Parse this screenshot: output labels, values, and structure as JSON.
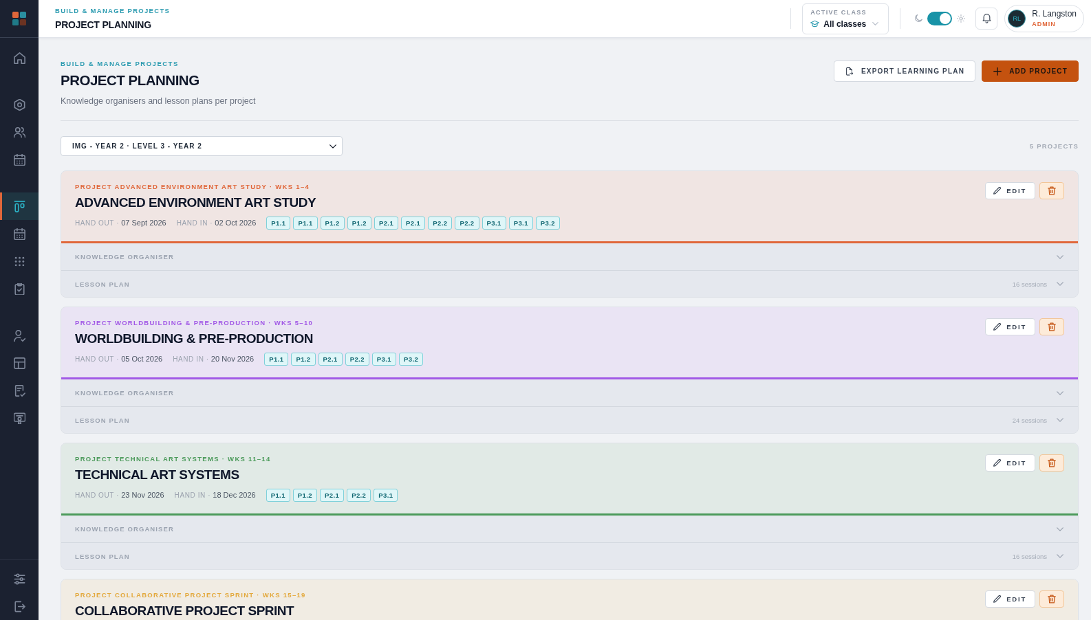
{
  "sidebar": {
    "groups": [
      {
        "items": [
          {
            "selected": false
          }
        ]
      },
      {
        "items": [
          {
            "selected": false
          },
          {
            "selected": false
          },
          {
            "selected": false
          }
        ]
      },
      {
        "items": [
          {
            "selected": true
          },
          {
            "selected": false
          },
          {
            "selected": false
          },
          {
            "selected": false
          }
        ]
      },
      {
        "items": [
          {
            "selected": false
          },
          {
            "selected": false
          },
          {
            "selected": false
          },
          {
            "selected": false
          }
        ]
      }
    ]
  },
  "header": {
    "kicker": "BUILD & MANAGE PROJECTS",
    "title": "PROJECT PLANNING",
    "active_class": {
      "label": "ACTIVE CLASS",
      "value": "All classes"
    },
    "theme_toggle": {
      "on": true
    },
    "user": {
      "initials": "RL",
      "name": "R. Langston",
      "role": "ADMIN"
    }
  },
  "page": {
    "kicker": "BUILD & MANAGE PROJECTS",
    "title": "PROJECT PLANNING",
    "subtitle": "Knowledge organisers and lesson plans per project",
    "buttons": [
      {
        "label": "EXPORT LEARNING PLAN",
        "kind": "secondary"
      },
      {
        "label": "ADD PROJECT",
        "kind": "primary"
      }
    ],
    "class_select": {
      "value": "IMG - YEAR 2 · LEVEL 3 - YEAR 2"
    },
    "project_count": "5 PROJECTS"
  },
  "projects": [
    {
      "kicker": "PROJECT ADVANCED ENVIRONMENT ART STUDY · WKS 1–4",
      "title": "ADVANCED ENVIRONMENT ART STUDY",
      "color": "#e0673a",
      "hand_out": {
        "label": "HAND OUT ·",
        "date": "07 Sept 2026"
      },
      "hand_in": {
        "label": "HAND IN ·",
        "date": "02 Oct 2026"
      },
      "criteria": [
        "P1.1",
        "P1.1",
        "P1.2",
        "P1.2",
        "P2.1",
        "P2.1",
        "P2.2",
        "P2.2",
        "P3.1",
        "P3.1",
        "P3.2"
      ],
      "edit_label": "EDIT",
      "sections": [
        {
          "label": "KNOWLEDGE ORGANISER",
          "expanded": false
        },
        {
          "label": "LESSON PLAN",
          "count": "16 sessions",
          "expanded": false
        }
      ]
    },
    {
      "kicker": "PROJECT WORLDBUILDING & PRE-PRODUCTION · WKS 5–10",
      "title": "WORLDBUILDING & PRE-PRODUCTION",
      "color": "#a259e6",
      "hand_out": {
        "label": "HAND OUT ·",
        "date": "05 Oct 2026"
      },
      "hand_in": {
        "label": "HAND IN ·",
        "date": "20 Nov 2026"
      },
      "criteria": [
        "P1.1",
        "P1.2",
        "P2.1",
        "P2.2",
        "P3.1",
        "P3.2"
      ],
      "edit_label": "EDIT",
      "sections": [
        {
          "label": "KNOWLEDGE ORGANISER",
          "expanded": false
        },
        {
          "label": "LESSON PLAN",
          "count": "24 sessions",
          "expanded": false
        }
      ]
    },
    {
      "kicker": "PROJECT TECHNICAL ART SYSTEMS · WKS 11–14",
      "title": "TECHNICAL ART SYSTEMS",
      "color": "#4b9a5a",
      "hand_out": {
        "label": "HAND OUT ·",
        "date": "23 Nov 2026"
      },
      "hand_in": {
        "label": "HAND IN ·",
        "date": "18 Dec 2026"
      },
      "criteria": [
        "P1.1",
        "P1.2",
        "P2.1",
        "P2.2",
        "P3.1"
      ],
      "edit_label": "EDIT",
      "sections": [
        {
          "label": "KNOWLEDGE ORGANISER",
          "expanded": false
        },
        {
          "label": "LESSON PLAN",
          "count": "16 sessions",
          "expanded": false
        }
      ]
    },
    {
      "kicker": "PROJECT COLLABORATIVE PROJECT SPRINT · WKS 15–19",
      "title": "COLLABORATIVE PROJECT SPRINT",
      "color": "#e3a83b",
      "edit_label": "EDIT"
    }
  ]
}
